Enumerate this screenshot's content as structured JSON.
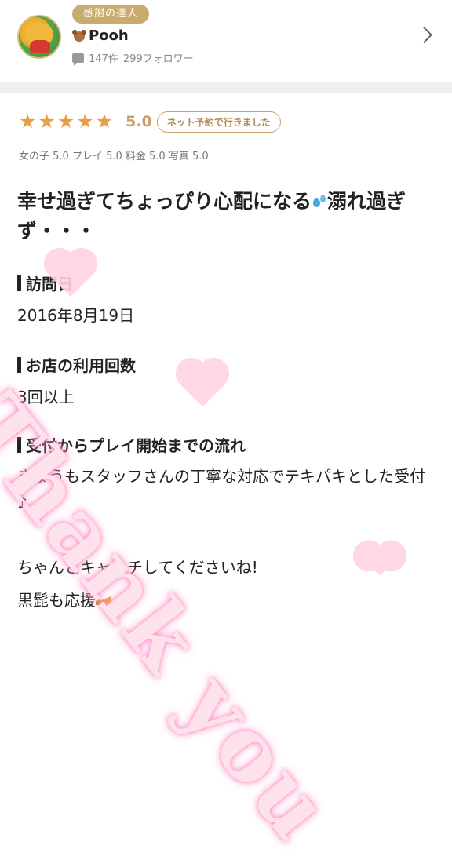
{
  "reviewer": {
    "badge": "感謝の達人",
    "name": "Pooh",
    "posts": "147件",
    "followers": "299フォロワー"
  },
  "rating": {
    "stars": 5,
    "score": "5.0",
    "reservation_chip": "ネット予約で行きました",
    "subratings": "女の子 5.0  プレイ 5.0  料金 5.0  写真 5.0"
  },
  "review": {
    "title_part1": "幸せ過ぎてちょっぴり心配になる",
    "title_part2": "溺れ過ぎず・・・",
    "visit_date_label": "訪問日",
    "visit_date": "2016年8月19日",
    "visits_label": "お店の利用回数",
    "visits": "3回以上",
    "flow_label": "受付からプレイ開始までの流れ",
    "flow_line1": "きょうもスタッフさんの丁寧な対応でテキパキとした受付♪",
    "line2": "ちゃんとキャッチしてくださいね!",
    "line3": "黒髭も応援"
  },
  "watermark": "Thank you",
  "icons": {
    "avatar": "pooh-avatar",
    "name_prefix": "bear-icon",
    "posts": "comment-icon",
    "nav": "chevron-right-icon",
    "title_emoji": "sweat-drops-icon",
    "line3_emoji": "megaphone-icon"
  },
  "colors": {
    "badge": "#c9ab6d",
    "stars": "#e8a04a",
    "score": "#c9a06a",
    "watermark": "#ff8fc0"
  }
}
